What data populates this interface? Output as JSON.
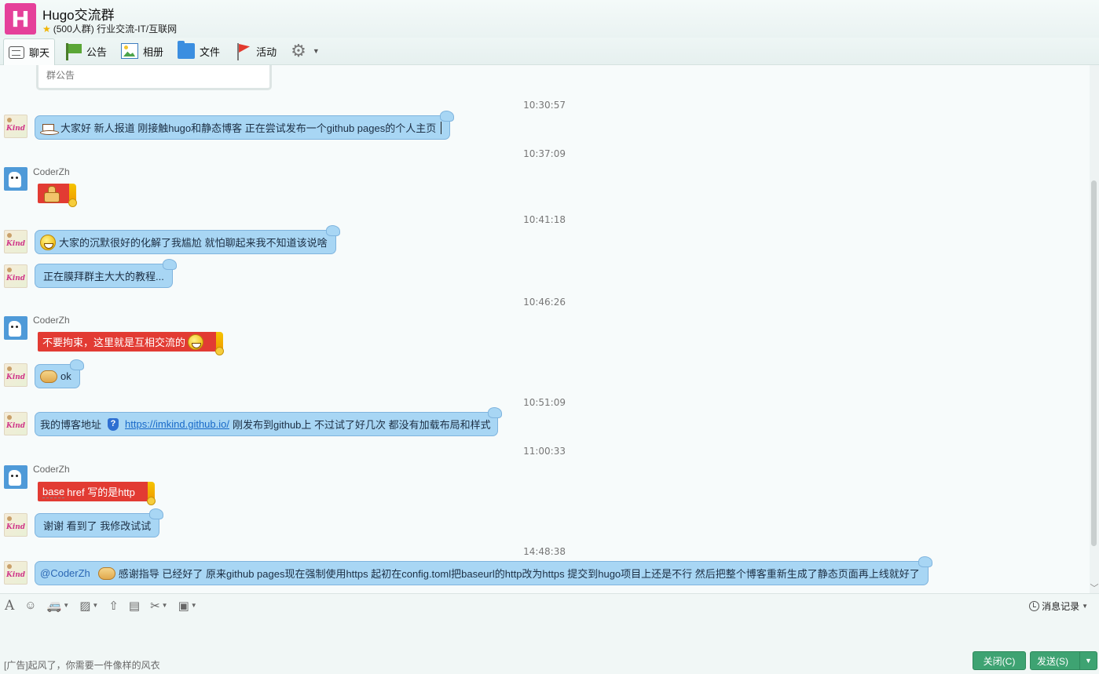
{
  "header": {
    "avatar_letter": "H",
    "title": "Hugo交流群",
    "subtitle": "(500人群) 行业交流-IT/互联网"
  },
  "tabs": [
    {
      "label": "聊天",
      "icon": "chat-icon"
    },
    {
      "label": "公告",
      "icon": "flag-icon"
    },
    {
      "label": "相册",
      "icon": "photo-icon"
    },
    {
      "label": "文件",
      "icon": "folder-icon"
    },
    {
      "label": "活动",
      "icon": "activity-flag-icon"
    }
  ],
  "notice_placeholder": "群公告",
  "messages": {
    "ts1": "10:30:57",
    "m1": "大家好  新人报道   刚接触hugo和静态博客   正在尝试发布一个github pages的个人主页",
    "ts2": "10:37:09",
    "sender": "CoderZh",
    "ts3": "10:41:18",
    "m3": "大家的沉默很好的化解了我尴尬  就怕聊起来我不知道该说啥",
    "m4": "正在膜拜群主大大的教程...",
    "ts4": "10:46:26",
    "m5": "不要拘束，这里就是互相交流的",
    "m6": "ok",
    "ts5": "10:51:09",
    "m7_pre": "我的博客地址",
    "m7_link": "https://imkind.github.io/",
    "m7_post": "  刚发布到github上  不过试了好几次  都没有加载布局和样式",
    "ts6": "11:00:33",
    "m8_a": "base",
    "m8_b": " href 写的是http",
    "m9": "谢谢 看到了  我修改试试",
    "ts7": "14:48:38",
    "m10_mention": "@CoderZh",
    "m10": "感谢指导    已经好了    原来github pages现在强制使用https  起初在config.toml把baseurl的http改为https  提交到hugo项目上还是不行  然后把整个博客重新生成了静态页面再上线就好了"
  },
  "input": {
    "history_label": "消息记录",
    "ad_text": "[广告]起风了，你需要一件像样的风衣",
    "close_label": "关闭(C)",
    "send_label": "发送(S)"
  },
  "colors": {
    "bubble": "#a8d6f4",
    "red_bubble": "#e23b33",
    "button_green": "#3ea372",
    "group_avatar": "#e5409a"
  }
}
